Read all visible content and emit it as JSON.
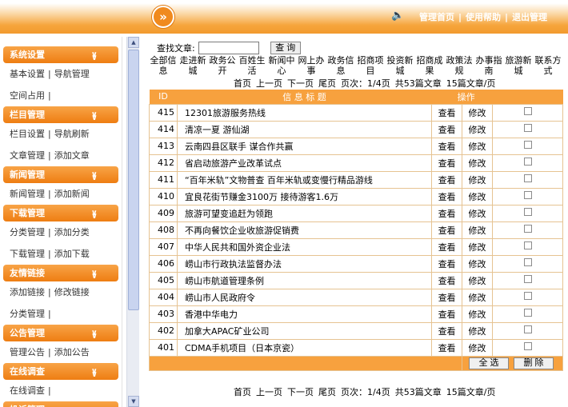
{
  "header": {
    "logo_glyph": "»",
    "links": [
      "管理首页",
      "使用帮助",
      "退出管理"
    ]
  },
  "sidebar": {
    "groups": [
      {
        "title": "系统设置",
        "rows": [
          [
            "基本设置",
            "导航管理"
          ],
          [
            "空间占用"
          ]
        ]
      },
      {
        "title": "栏目管理",
        "rows": [
          [
            "栏目设置",
            "导航刷新"
          ],
          [
            "文章管理",
            "添加文章"
          ]
        ]
      },
      {
        "title": "新闻管理",
        "rows": [
          [
            "新闻管理",
            "添加新闻"
          ]
        ]
      },
      {
        "title": "下载管理",
        "rows": [
          [
            "分类管理",
            "添加分类"
          ],
          [
            "下载管理",
            "添加下载"
          ]
        ]
      },
      {
        "title": "友情链接",
        "rows": [
          [
            "添加链接",
            "修改链接"
          ],
          [
            "分类管理"
          ]
        ]
      },
      {
        "title": "公告管理",
        "rows": [
          [
            "管理公告",
            "添加公告"
          ]
        ]
      },
      {
        "title": "在线调查",
        "rows": [
          [
            "在线调查"
          ]
        ]
      },
      {
        "title": "投诉管理",
        "rows": []
      }
    ]
  },
  "search": {
    "label": "查找文章:",
    "value": "",
    "button": "查 询"
  },
  "categories": [
    [
      "全部信",
      "息"
    ],
    [
      "走进新",
      "城"
    ],
    [
      "政务公",
      "开"
    ],
    [
      "百姓生",
      "活"
    ],
    [
      "新闻中",
      "心"
    ],
    [
      "网上办",
      "事"
    ],
    [
      "政务信",
      "息"
    ],
    [
      "招商项",
      "目"
    ],
    [
      "投资新",
      "城"
    ],
    [
      "招商成",
      "果"
    ],
    [
      "政策法",
      "规"
    ],
    [
      "办事指",
      "南"
    ],
    [
      "旅游新",
      "城"
    ],
    [
      "联系方",
      "式"
    ]
  ],
  "pager": {
    "first": "首页",
    "prev": "上一页",
    "next": "下一页",
    "last": "尾页",
    "page_info": "页次：1/4页",
    "total": "共53篇文章",
    "per_page": "15篇文章/页"
  },
  "table": {
    "headers": {
      "id": "ID",
      "title": "信 息 标 题",
      "ops": "操作"
    },
    "view_label": "查看",
    "edit_label": "修改",
    "rows": [
      {
        "id": "415",
        "title": "12301旅游服务热线"
      },
      {
        "id": "414",
        "title": "清凉一夏 游仙湖"
      },
      {
        "id": "413",
        "title": "云南四县区联手 谋合作共赢"
      },
      {
        "id": "412",
        "title": "省启动旅游产业改革试点"
      },
      {
        "id": "411",
        "title": "“百年米轨”文物普查 百年米轨或变慢行精品游线"
      },
      {
        "id": "410",
        "title": "宜良花街节赚金3100万 接待游客1.6万"
      },
      {
        "id": "409",
        "title": "旅游可望变追赶为领跑"
      },
      {
        "id": "408",
        "title": "不再向餐饮企业收旅游促销费"
      },
      {
        "id": "407",
        "title": "中华人民共和国外资企业法"
      },
      {
        "id": "406",
        "title": "崂山市行政执法监督办法"
      },
      {
        "id": "405",
        "title": "崂山市航道管理条例"
      },
      {
        "id": "404",
        "title": "崂山市人民政府令"
      },
      {
        "id": "403",
        "title": "香港中华电力"
      },
      {
        "id": "402",
        "title": "加拿大APAC矿业公司"
      },
      {
        "id": "401",
        "title": "CDMA手机项目（日本京瓷）"
      }
    ],
    "select_all": "全 选",
    "delete": "删 除"
  }
}
